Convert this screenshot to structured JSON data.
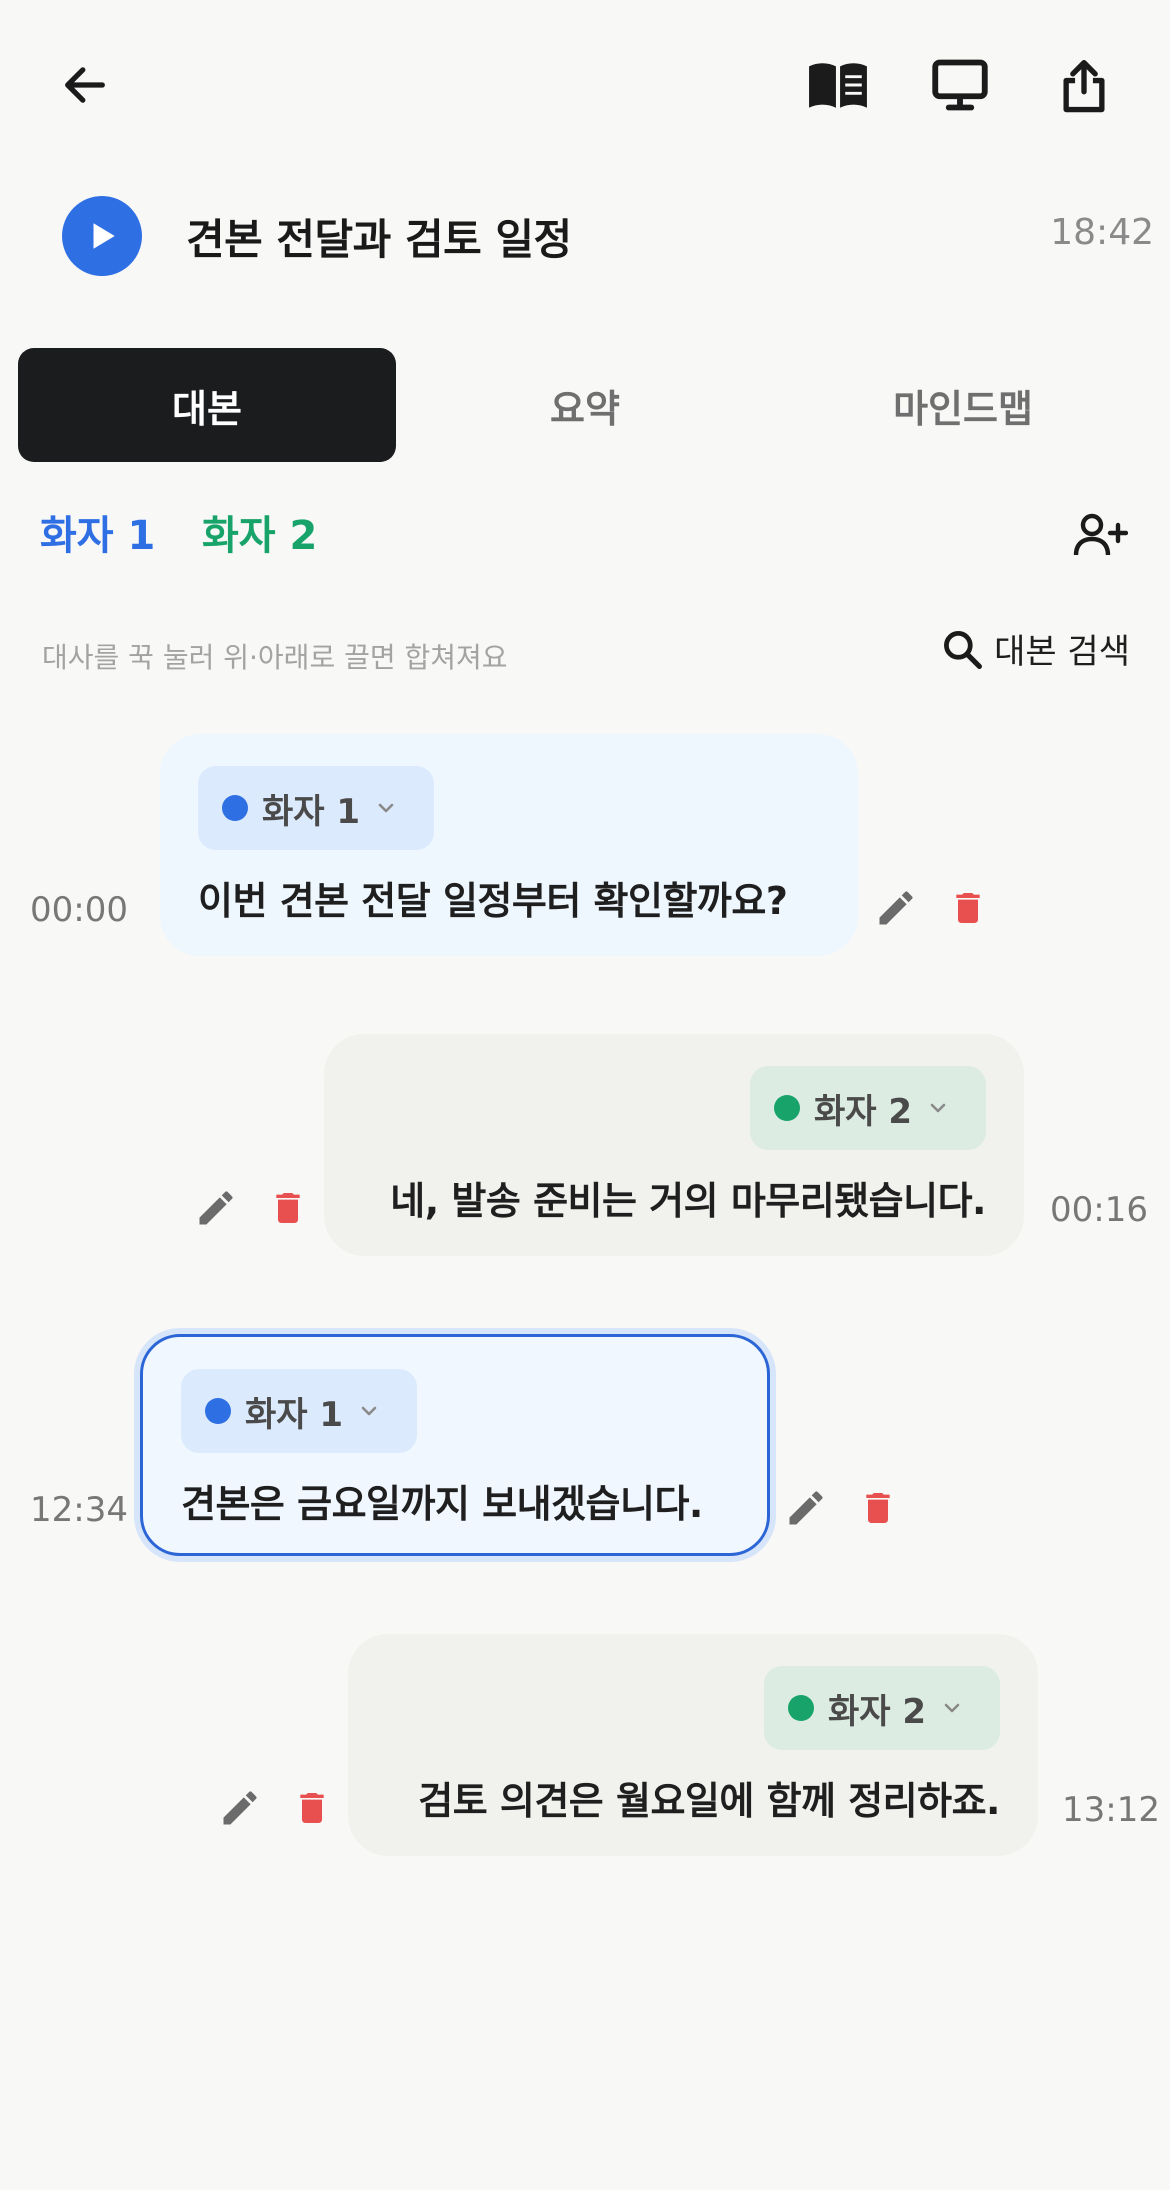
{
  "recording": {
    "title": "견본 전달과 검토 일정",
    "duration": "18:42"
  },
  "tabs": [
    {
      "label": "대본",
      "active": true
    },
    {
      "label": "요약",
      "active": false
    },
    {
      "label": "마인드맵",
      "active": false
    }
  ],
  "speakers": [
    {
      "name": "화자 1",
      "color": "#2f6fe4"
    },
    {
      "name": "화자 2",
      "color": "#18a36a"
    }
  ],
  "hint": "대사를 꾹 눌러 위·아래로 끌면 합쳐져요",
  "search_label": "대본 검색",
  "utterances": [
    {
      "speaker": "화자 1",
      "text": "이번 견본 전달 일정부터 확인할까요?",
      "time": "00:00"
    },
    {
      "speaker": "화자 2",
      "text": "네, 발송 준비는 거의 마무리됐습니다.",
      "time": "00:16"
    },
    {
      "speaker": "화자 1",
      "text": "견본은 금요일까지 보내겠습니다.",
      "time": "12:34",
      "selected": true
    },
    {
      "speaker": "화자 2",
      "text": "검토 의견은 월요일에 함께 정리하죠.",
      "time": "13:12"
    }
  ],
  "icons": {
    "back": "arrow-left-icon",
    "book": "book-icon",
    "monitor": "monitor-icon",
    "share": "share-icon",
    "play": "play-icon",
    "add_person": "add-person-icon",
    "search": "search-icon",
    "edit": "pencil-icon",
    "delete": "trash-icon",
    "chevron": "chevron-down-icon"
  },
  "colors": {
    "accent": "#2f6fe4",
    "speaker2": "#18a36a",
    "delete": "#e8504f",
    "edit": "#6b6b6b"
  }
}
